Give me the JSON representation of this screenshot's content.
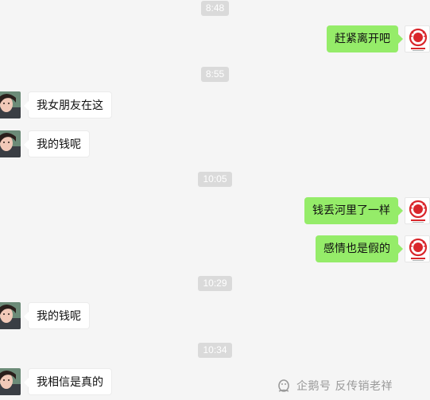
{
  "chat": {
    "messages": [
      {
        "id": "t1",
        "type": "timestamp",
        "text": "8:48"
      },
      {
        "id": "m1",
        "type": "outgoing",
        "text": "赶紧离开吧"
      },
      {
        "id": "t2",
        "type": "timestamp",
        "text": "8:55"
      },
      {
        "id": "m2",
        "type": "incoming",
        "text": "我女朋友在这"
      },
      {
        "id": "m3",
        "type": "incoming",
        "text": "我的钱呢"
      },
      {
        "id": "t3",
        "type": "timestamp",
        "text": "10:05"
      },
      {
        "id": "m4",
        "type": "outgoing",
        "text": "钱丢河里了一样"
      },
      {
        "id": "m5",
        "type": "outgoing",
        "text": "感情也是假的"
      },
      {
        "id": "t4",
        "type": "timestamp",
        "text": "10:29"
      },
      {
        "id": "m6",
        "type": "incoming",
        "text": "我的钱呢"
      },
      {
        "id": "t5",
        "type": "timestamp",
        "text": "10:34"
      },
      {
        "id": "m7",
        "type": "incoming",
        "text": "我相信是真的"
      }
    ]
  },
  "watermark": {
    "text": "企鹅号 反传销老祥",
    "icon": "penguin-logo-icon"
  },
  "colors": {
    "background": "#f5f5f5",
    "outgoing_bubble": "#95ec69",
    "incoming_bubble": "#ffffff",
    "timestamp_bg": "#dadada",
    "logo_red": "#d9262b"
  },
  "avatars": {
    "left": "contact-avatar",
    "right": "red-seal-logo-avatar"
  }
}
